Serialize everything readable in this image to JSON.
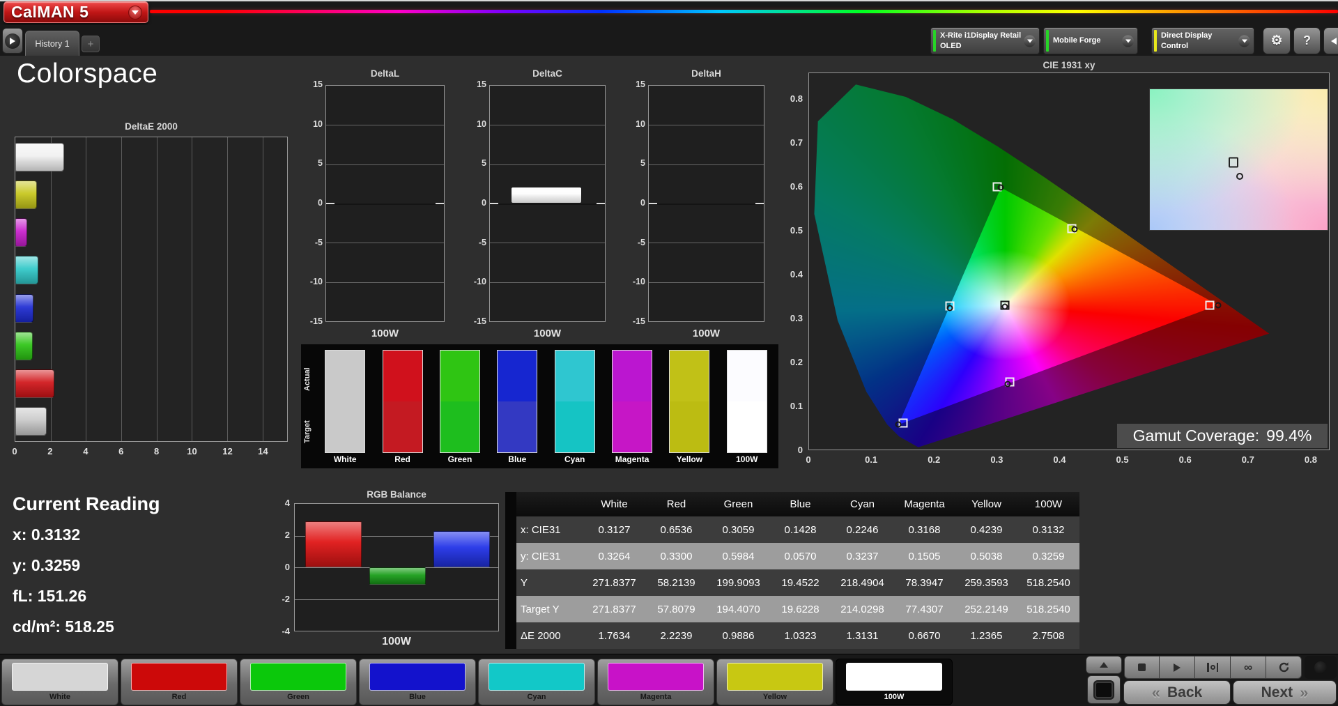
{
  "window": {
    "logo_text": "CalMAN",
    "logo_version": "5",
    "tab_history": "History 1",
    "add_tab": "+",
    "meter_dropdown_line1": "X-Rite i1Display Retail",
    "meter_dropdown_line2": "OLED",
    "source_dropdown": "Mobile Forge",
    "display_dropdown": "Direct Display Control",
    "help_label": "?"
  },
  "page": {
    "title": "Colorspace"
  },
  "charts": {
    "delta_e": {
      "type": "bar",
      "title": "DeltaE 2000",
      "xticks": [
        0,
        2,
        4,
        6,
        8,
        10,
        12,
        14
      ],
      "xmax": 15.4,
      "bars": [
        {
          "name": "100W",
          "value": 2.7508,
          "color": "#f0f0f0"
        },
        {
          "name": "Yellow",
          "value": 1.2365,
          "color": "#c6c61a"
        },
        {
          "name": "Magenta",
          "value": 0.667,
          "color": "#c81ecc"
        },
        {
          "name": "Cyan",
          "value": 1.3131,
          "color": "#2fc8c8"
        },
        {
          "name": "Blue",
          "value": 1.0323,
          "color": "#1c2ad2"
        },
        {
          "name": "Green",
          "value": 0.9886,
          "color": "#2cc414"
        },
        {
          "name": "Red",
          "value": 2.2239,
          "color": "#d01418"
        },
        {
          "name": "White",
          "value": 1.7634,
          "color": "#c9c9c9"
        }
      ]
    },
    "delta_lch": {
      "type": "bar",
      "ymin": -15,
      "ymax": 15,
      "yticks": [
        15,
        10,
        5,
        0,
        -5,
        -10,
        -15
      ],
      "xlabel": "100W",
      "charts": [
        {
          "title": "DeltaL",
          "value": 0.0
        },
        {
          "title": "DeltaC",
          "value": 2.1
        },
        {
          "title": "DeltaH",
          "value": 0.0
        }
      ]
    },
    "swatch_compare": {
      "row_labels": [
        "Actual",
        "Target"
      ],
      "columns": [
        {
          "name": "White",
          "actual": "#c9c9c9",
          "target": "#c9c9c9"
        },
        {
          "name": "Red",
          "actual": "#d0111c",
          "target": "#c41a22"
        },
        {
          "name": "Green",
          "actual": "#2fc513",
          "target": "#1ebe1e"
        },
        {
          "name": "Blue",
          "actual": "#1626d0",
          "target": "#3339c2"
        },
        {
          "name": "Cyan",
          "actual": "#2fc6d0",
          "target": "#15c4c4"
        },
        {
          "name": "Magenta",
          "actual": "#bb16d0",
          "target": "#c616c6"
        },
        {
          "name": "Yellow",
          "actual": "#c1c117",
          "target": "#bcbc12"
        },
        {
          "name": "100W",
          "actual": "#fcfcff",
          "target": "#ffffff"
        }
      ]
    },
    "cie": {
      "type": "scatter",
      "title": "CIE 1931 xy",
      "xlim": [
        0,
        0.83
      ],
      "ylim": [
        0,
        0.86
      ],
      "xticks": [
        0,
        0.1,
        0.2,
        0.3,
        0.4,
        0.5,
        0.6,
        0.7,
        0.8
      ],
      "yticks": [
        0,
        0.1,
        0.2,
        0.3,
        0.4,
        0.5,
        0.6,
        0.7,
        0.8
      ],
      "gamut_coverage_label": "Gamut Coverage:",
      "gamut_coverage_value": "99.4%",
      "points": [
        {
          "name": "White",
          "target_x": 0.3127,
          "target_y": 0.329,
          "x": 0.3127,
          "y": 0.3264,
          "dark": true
        },
        {
          "name": "Red",
          "target_x": 0.64,
          "target_y": 0.33,
          "x": 0.6536,
          "y": 0.33
        },
        {
          "name": "Green",
          "target_x": 0.3,
          "target_y": 0.6,
          "x": 0.3059,
          "y": 0.5984
        },
        {
          "name": "Blue",
          "target_x": 0.15,
          "target_y": 0.06,
          "x": 0.1428,
          "y": 0.057
        },
        {
          "name": "Cyan",
          "target_x": 0.2246,
          "target_y": 0.3287,
          "x": 0.2246,
          "y": 0.3237
        },
        {
          "name": "Magenta",
          "target_x": 0.3209,
          "target_y": 0.1542,
          "x": 0.3168,
          "y": 0.1505
        },
        {
          "name": "Yellow",
          "target_x": 0.4193,
          "target_y": 0.5053,
          "x": 0.4239,
          "y": 0.5038
        }
      ],
      "gamut_triangle": [
        "Red",
        "Green",
        "Blue"
      ]
    },
    "rgb_balance": {
      "type": "bar",
      "title": "RGB Balance",
      "ymin": -4,
      "ymax": 4,
      "yticks": [
        4,
        2,
        0,
        -2,
        -4
      ],
      "xlabel": "100W",
      "bars": [
        {
          "name": "Red",
          "value": 2.9,
          "color": "#e01616"
        },
        {
          "name": "Green",
          "value": -1.1,
          "color": "#1a9e1a"
        },
        {
          "name": "Blue",
          "value": 2.3,
          "color": "#2233e8"
        }
      ]
    }
  },
  "current_reading": {
    "title": "Current Reading",
    "lines": [
      {
        "label": "x:",
        "value": "0.3132"
      },
      {
        "label": "y:",
        "value": "0.3259"
      },
      {
        "label": "fL:",
        "value": "151.26"
      },
      {
        "label": "cd/m²:",
        "value": "518.25"
      }
    ]
  },
  "table": {
    "columns": [
      "White",
      "Red",
      "Green",
      "Blue",
      "Cyan",
      "Magenta",
      "Yellow",
      "100W"
    ],
    "rows": [
      {
        "label": "x: CIE31",
        "values": [
          "0.3127",
          "0.6536",
          "0.3059",
          "0.1428",
          "0.2246",
          "0.3168",
          "0.4239",
          "0.3132"
        ]
      },
      {
        "label": "y: CIE31",
        "values": [
          "0.3264",
          "0.3300",
          "0.5984",
          "0.0570",
          "0.3237",
          "0.1505",
          "0.5038",
          "0.3259"
        ]
      },
      {
        "label": "Y",
        "values": [
          "271.8377",
          "58.2139",
          "199.9093",
          "19.4522",
          "218.4904",
          "78.3947",
          "259.3593",
          "518.2540"
        ]
      },
      {
        "label": "Target Y",
        "values": [
          "271.8377",
          "57.8079",
          "194.4070",
          "19.6228",
          "214.0298",
          "77.4307",
          "252.2149",
          "518.2540"
        ]
      },
      {
        "label": "ΔE 2000",
        "values": [
          "1.7634",
          "2.2239",
          "0.9886",
          "1.0323",
          "1.3131",
          "0.6670",
          "1.2365",
          "2.7508"
        ]
      }
    ]
  },
  "pattern_buttons": [
    {
      "name": "White",
      "color": "#d6d6d6",
      "selected": false
    },
    {
      "name": "Red",
      "color": "#cc0909",
      "selected": false
    },
    {
      "name": "Green",
      "color": "#0bc80b",
      "selected": false
    },
    {
      "name": "Blue",
      "color": "#1312cc",
      "selected": false
    },
    {
      "name": "Cyan",
      "color": "#12c8c8",
      "selected": false
    },
    {
      "name": "Magenta",
      "color": "#c812c8",
      "selected": false
    },
    {
      "name": "Yellow",
      "color": "#c8c812",
      "selected": false
    },
    {
      "name": "100W",
      "color": "#ffffff",
      "selected": true
    }
  ],
  "footer": {
    "back_label": "Back",
    "next_label": "Next"
  }
}
